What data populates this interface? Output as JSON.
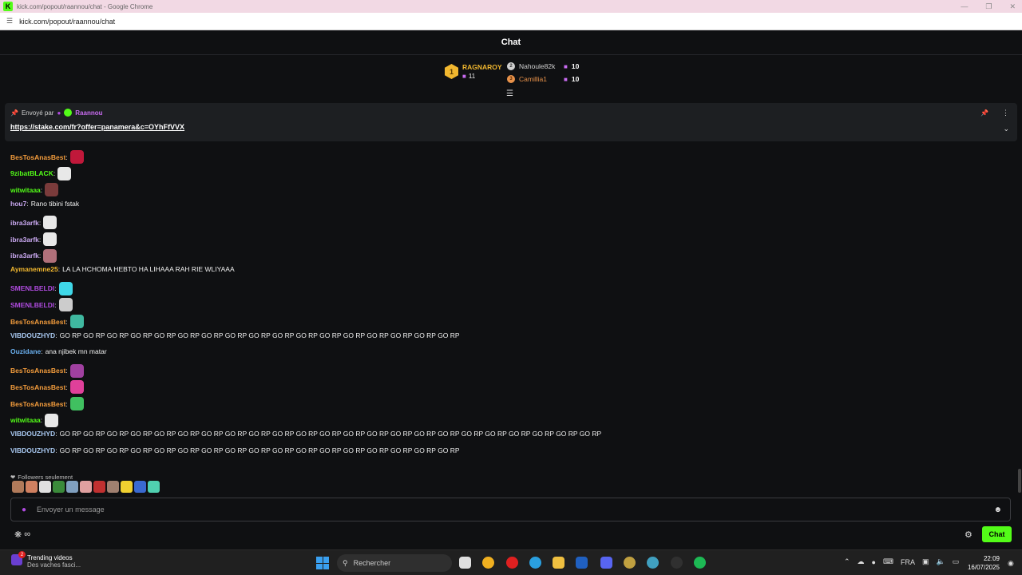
{
  "browser": {
    "window_title": "kick.com/popout/raannou/chat - Google Chrome",
    "favicon_letter": "K",
    "url": "kick.com/popout/raannou/chat"
  },
  "chat": {
    "header_title": "Chat",
    "leaderboard": {
      "first": {
        "rank": "1",
        "name": "RAGNAROY",
        "count": "11"
      },
      "others": [
        {
          "rank": "2",
          "name": "Nahoule82k",
          "count": "10",
          "color": "#d0d0d0"
        },
        {
          "rank": "3",
          "name": "Camillia1",
          "count": "10",
          "color": "#e8924a"
        }
      ]
    },
    "pinned": {
      "sent_by_label": "Envoyé par",
      "sender": "Raannou",
      "link": "https://stake.com/fr?offer=panamera&c=OYhFfVVX"
    },
    "messages": [
      {
        "user": "BesTosAnasBest",
        "color": "#f39c3c",
        "text": "",
        "emote_color": "#c0183a"
      },
      {
        "user": "9zibatBLACK",
        "color": "#53fc18",
        "text": "",
        "emote_color": "#e8e8e8"
      },
      {
        "user": "witwitaaa",
        "color": "#53fc18",
        "text": "",
        "emote_color": "#7a3b3b"
      },
      {
        "user": "hou7",
        "color": "#c9a8f0",
        "text": "Rano tibini fstak",
        "emote_color": ""
      },
      {
        "user": "ibra3arfk",
        "color": "#c9a8f0",
        "text": "",
        "emote_color": "#e8e8e8"
      },
      {
        "user": "ibra3arfk",
        "color": "#c9a8f0",
        "text": "",
        "emote_color": "#e8e8e8"
      },
      {
        "user": "ibra3arfk",
        "color": "#c9a8f0",
        "text": "",
        "emote_color": "#b0707a"
      },
      {
        "user": "Aymanemne25",
        "color": "#f1b72f",
        "text": "LA LA HCHOMA HEBTO HA LIHAAA RAH RIE WLIYAAA",
        "emote_color": ""
      },
      {
        "user": "SMENLBELDI",
        "color": "#b04be0",
        "text": "",
        "emote_color": "#3fd8e8"
      },
      {
        "user": "SMENLBELDI",
        "color": "#b04be0",
        "text": "",
        "emote_color": "#cccccc"
      },
      {
        "user": "BesTosAnasBest",
        "color": "#f39c3c",
        "text": "",
        "emote_color": "#3fb8a0"
      },
      {
        "user": "VIBDOUZHYD",
        "color": "#a8c8f0",
        "text": "GO RP GO RP GO RP GO RP GO RP GO RP GO RP GO RP GO RP GO RP GO RP GO RP GO RP GO RP GO RP GO RP GO RP",
        "emote_color": ""
      },
      {
        "user": "Ouzidane",
        "color": "#6ab0f0",
        "text": "ana njibek mn matar",
        "emote_color": ""
      },
      {
        "user": "BesTosAnasBest",
        "color": "#f39c3c",
        "text": "",
        "emote_color": "#a040a0"
      },
      {
        "user": "BesTosAnasBest",
        "color": "#f39c3c",
        "text": "",
        "emote_color": "#e0409a"
      },
      {
        "user": "BesTosAnasBest",
        "color": "#f39c3c",
        "text": "",
        "emote_color": "#40c060"
      },
      {
        "user": "witwitaaa",
        "color": "#53fc18",
        "text": "",
        "emote_color": "#e8e8e8"
      },
      {
        "user": "VIBDOUZHYD",
        "color": "#a8c8f0",
        "text": "GO RP GO RP GO RP GO RP GO RP GO RP GO RP GO RP GO RP GO RP GO RP GO RP GO RP GO RP GO RP GO RP GO RP GO RP GO RP GO RP GO RP GO RP GO RP",
        "emote_color": ""
      },
      {
        "user": "VIBDOUZHYD",
        "color": "#a8c8f0",
        "text": "GO RP GO RP GO RP GO RP GO RP GO RP GO RP GO RP GO RP GO RP GO RP GO RP GO RP GO RP GO RP GO RP GO RP",
        "emote_color": ""
      }
    ],
    "followers_only_label": "Followers seulement",
    "emote_strip_colors": [
      "#b07a5a",
      "#d08060",
      "#e0e0e0",
      "#3a8a3a",
      "#80a0c0",
      "#e0a0a0",
      "#c03030",
      "#a08070",
      "#f0d030",
      "#3a6ad0",
      "#50d0b0"
    ],
    "input_placeholder": "Envoyer un message",
    "send_label": "Chat"
  },
  "taskbar": {
    "trending_title": "Trending videos",
    "trending_sub": "Des vaches fasci...",
    "trending_badge": "2",
    "search_placeholder": "Rechercher",
    "language": "FRA",
    "time": "22:09",
    "date": "16/07/2025"
  }
}
